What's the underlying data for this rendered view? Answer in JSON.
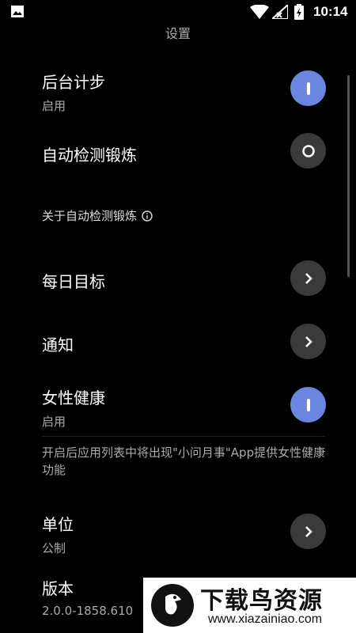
{
  "status_bar": {
    "time": "10:14"
  },
  "page_title": "设置",
  "rows": {
    "background_steps": {
      "label": "后台计步",
      "sub": "启用"
    },
    "auto_detect": {
      "label": "自动检测锻炼"
    },
    "daily_goal": {
      "label": "每日目标"
    },
    "notifications": {
      "label": "通知"
    },
    "female_health": {
      "label": "女性健康",
      "sub": "启用"
    },
    "units": {
      "label": "单位",
      "sub": "公制"
    },
    "version": {
      "label": "版本",
      "sub": "2.0.0-1858.610"
    }
  },
  "about_auto_detect": "关于自动检测锻炼",
  "female_health_desc": "开启后应用列表中将出现\"小问月事\"App提供女性健康功能",
  "watermark": {
    "name": "下载鸟资源",
    "url": "www.xiazainiao.com"
  },
  "colors": {
    "toggle_on": "#6a86e0",
    "toggle_off": "#3a3a3a",
    "background": "#000000"
  }
}
